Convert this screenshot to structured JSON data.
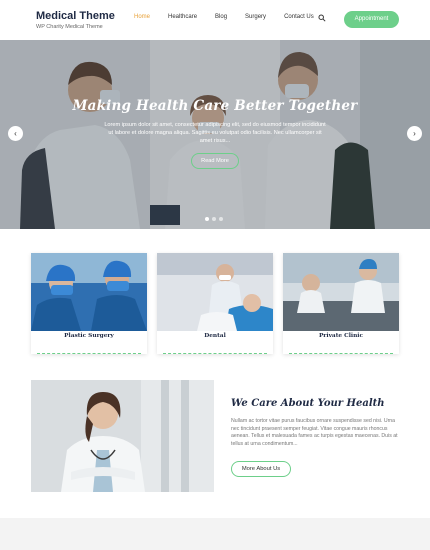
{
  "brand": {
    "title": "Medical Theme",
    "tagline": "WP Charity Medical Theme"
  },
  "nav": [
    "Home",
    "Healthcare",
    "Blog",
    "Surgery",
    "Contact Us"
  ],
  "appointment_label": "Appointment",
  "hero": {
    "title": "Making Health Care Better Together",
    "text": "Lorem ipsum dolor sit amet, consectetur adipiscing elit, sed do eiusmod tempor incididunt ut labore et dolore magna aliqua. Sagittis eu volutpat odio facilisis. Nec ullamcorper sit amet risus...",
    "button": "Read More",
    "prev": "‹",
    "next": "›"
  },
  "services": [
    {
      "label": "Plastic Surgery"
    },
    {
      "label": "Dental"
    },
    {
      "label": "Private Clinic"
    }
  ],
  "about": {
    "title": "We Care About Your Health",
    "text": "Nullam ac tortor vitae purus faucibus ornare suspendisse sed nisi. Urna nec tincidunt praesent semper feugiat. Vitae congue mauris rhoncus aenean. Tellus et malesuada fames ac turpis egestas maecenas. Duis at tellus at urna condimentum...",
    "button": "More About Us"
  },
  "colors": {
    "accent": "#6dcf8a",
    "active_nav": "#e8a23a",
    "heading": "#1f2a44"
  }
}
